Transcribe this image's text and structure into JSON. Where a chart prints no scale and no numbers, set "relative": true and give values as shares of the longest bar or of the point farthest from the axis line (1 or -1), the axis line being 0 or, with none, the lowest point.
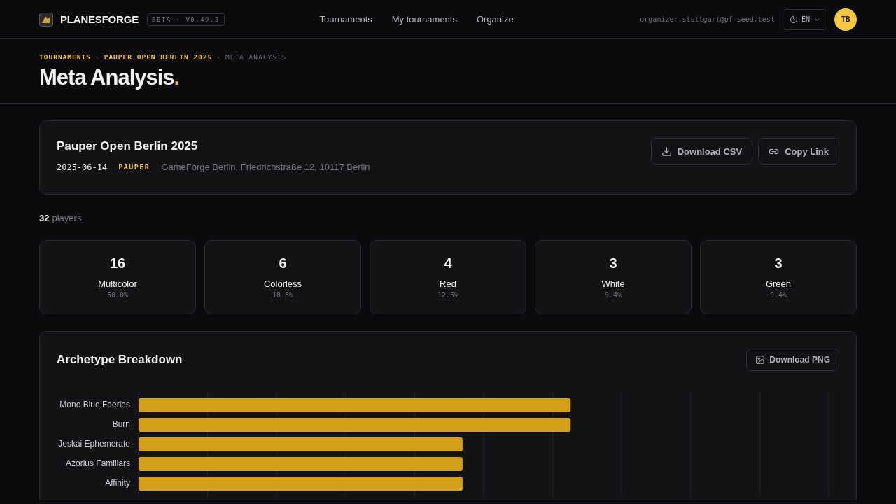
{
  "header": {
    "brand": "PLANESFORGE",
    "version_badge": "BETA · V0.49.3",
    "nav": [
      {
        "label": "Tournaments",
        "selected": false
      },
      {
        "label": "My tournaments",
        "selected": false
      },
      {
        "label": "Organize",
        "selected": false
      }
    ],
    "user_email": "organizer.stuttgart@pf-seed.test",
    "language": "EN",
    "avatar_initials": "TB"
  },
  "breadcrumbs": [
    {
      "label": "TOURNAMENTS",
      "current": false
    },
    {
      "label": "PAUPER OPEN BERLIN 2025",
      "current": false
    },
    {
      "label": "META ANALYSIS",
      "current": true
    }
  ],
  "breadcrumb_separator": "›",
  "page_title": "Meta Analysis",
  "title_mark": ".",
  "tournament": {
    "name": "Pauper Open Berlin 2025",
    "date": "2025-06-14",
    "format": "PAUPER",
    "location": "GameForge Berlin, Friedrichstraße 12, 10117 Berlin",
    "actions": [
      {
        "label": "Download CSV",
        "kind": "download"
      },
      {
        "label": "Copy Link",
        "kind": "link"
      }
    ]
  },
  "players": {
    "count": "32",
    "label": "players"
  },
  "color_stats": [
    {
      "count": "16",
      "name": "Multicolor",
      "percent": "50.0%"
    },
    {
      "count": "6",
      "name": "Colorless",
      "percent": "18.8%"
    },
    {
      "count": "4",
      "name": "Red",
      "percent": "12.5%"
    },
    {
      "count": "3",
      "name": "White",
      "percent": "9.4%"
    },
    {
      "count": "3",
      "name": "Green",
      "percent": "9.4%"
    }
  ],
  "archetype_panel": {
    "title": "Archetype Breakdown",
    "action": "Download PNG",
    "chart_data": {
      "type": "bar",
      "orientation": "horizontal",
      "relative": true,
      "categories": [
        "Mono Blue Faeries",
        "Burn",
        "Jeskai Ephemerate",
        "Azorius Familiars",
        "Affinity"
      ],
      "series": [
        {
          "color": "#d4a017",
          "values": [
            1,
            1,
            0.75,
            0.75,
            0.75
          ]
        }
      ]
    }
  }
}
